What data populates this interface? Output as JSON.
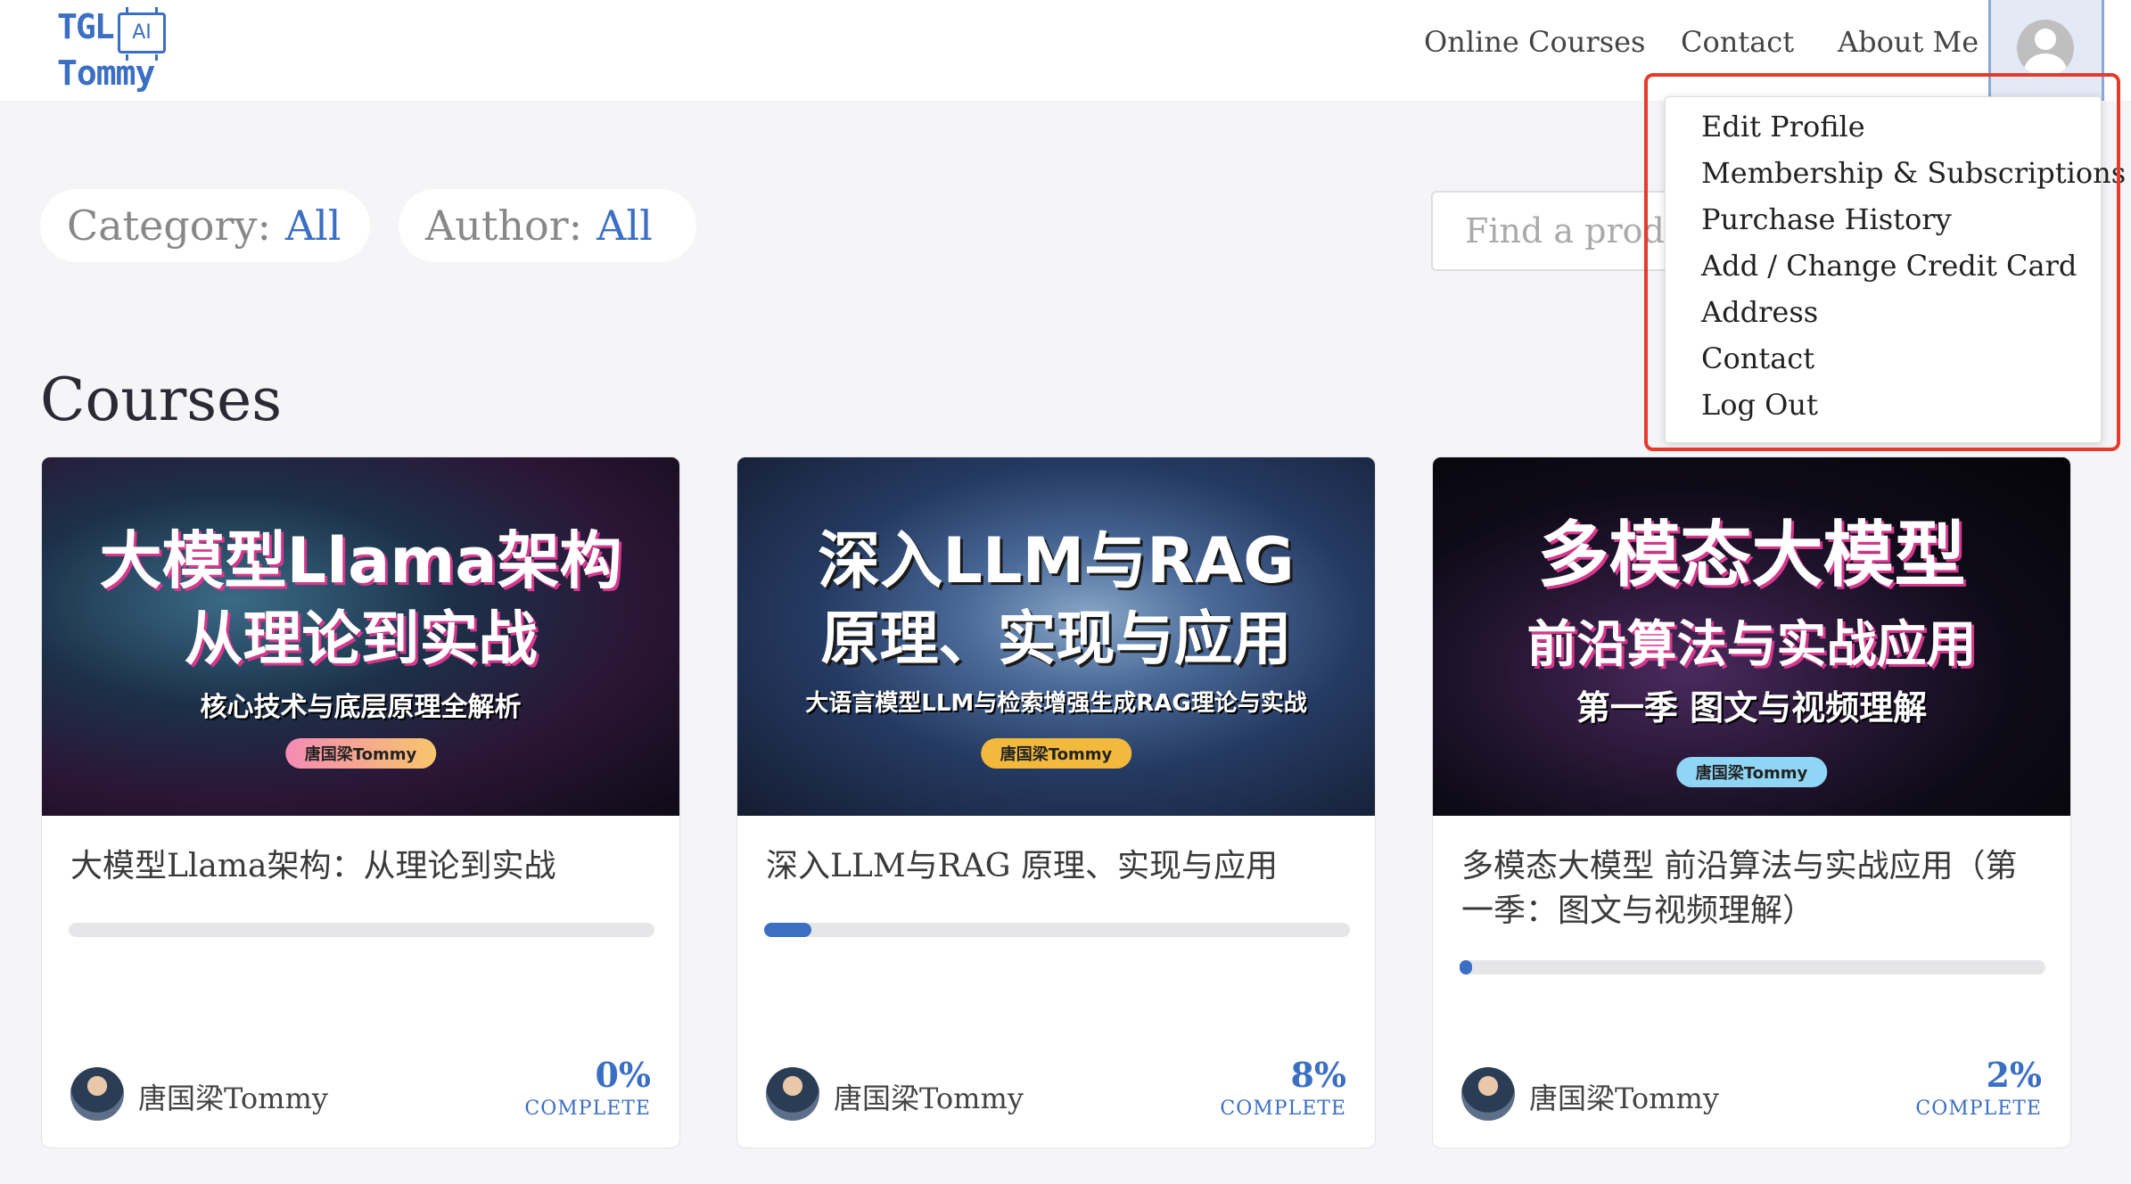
{
  "header": {
    "logo_line1": "TGL",
    "logo_chip": "AI",
    "logo_line2": "Tommy",
    "nav": [
      "Online Courses",
      "Contact",
      "About Me"
    ]
  },
  "filters": {
    "category_label": "Category:",
    "category_value": "All",
    "author_label": "Author:",
    "author_value": "All",
    "search_placeholder": "Find a produ"
  },
  "section_title": "Courses",
  "dropdown": {
    "items": [
      "Edit Profile",
      "Membership & Subscriptions",
      "Purchase History",
      "Add / Change Credit Card",
      "Address",
      "Contact",
      "Log Out"
    ]
  },
  "courses": [
    {
      "banner_line1": "大模型Llama架构",
      "banner_line2": "从理论到实战",
      "banner_line3": "核心技术与底层原理全解析",
      "banner_tag": "唐国梁Tommy",
      "title": "大模型Llama架构：从理论到实战",
      "progress": 0,
      "author": "唐国梁Tommy",
      "percent": "0%",
      "complete_label": "COMPLETE"
    },
    {
      "banner_line1": "深入LLM与RAG",
      "banner_line2": "原理、实现与应用",
      "banner_line3": "大语言模型LLM与检索增强生成RAG理论与实战",
      "banner_tag": "唐国梁Tommy",
      "title": "深入LLM与RAG 原理、实现与应用",
      "progress": 8,
      "author": "唐国梁Tommy",
      "percent": "8%",
      "complete_label": "COMPLETE"
    },
    {
      "banner_line1": "多模态大模型",
      "banner_line2": "前沿算法与实战应用",
      "banner_line3": "第一季 图文与视频理解",
      "banner_tag": "唐国梁Tommy",
      "title": "多模态大模型 前沿算法与实战应用（第一季：图文与视频理解）",
      "progress": 2,
      "author": "唐国梁Tommy",
      "percent": "2%",
      "complete_label": "COMPLETE"
    }
  ],
  "colors": {
    "accent": "#3b6fc4",
    "highlight_box": "#e53b2c"
  }
}
